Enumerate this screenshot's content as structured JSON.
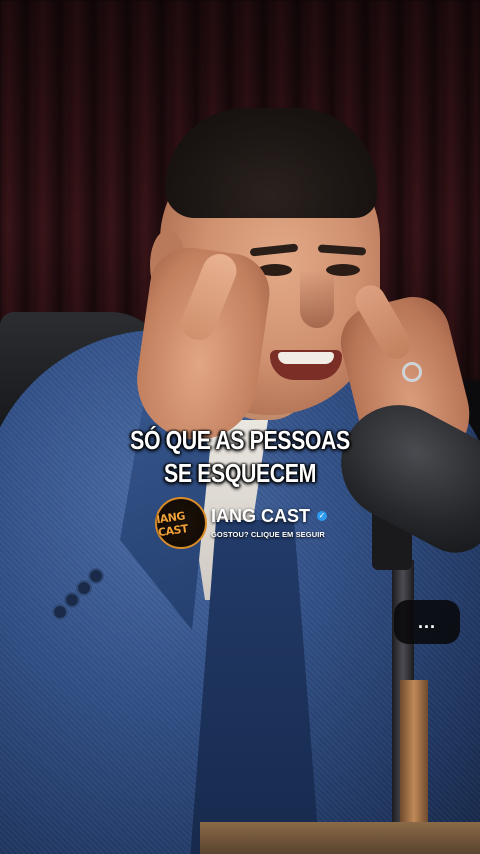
{
  "caption": {
    "line1": "SÓ QUE AS PESSOAS",
    "line2": "SE ESQUECEM"
  },
  "channel": {
    "logo_text": "IANG CAST",
    "name": "IANG CAST",
    "subtitle": "GOSTOU? CLIQUE EM SEGUIR",
    "verified": true
  },
  "more_button": {
    "label": "..."
  },
  "colors": {
    "logo_accent": "#d98b2a",
    "verified_badge": "#2d9cf0",
    "caption_text": "#ffffff"
  }
}
